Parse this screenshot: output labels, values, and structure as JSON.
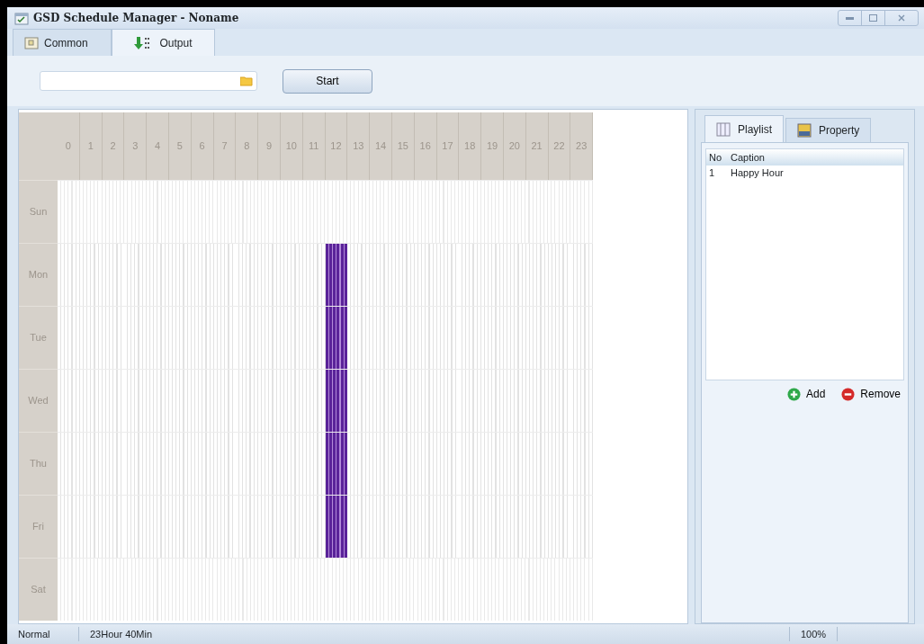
{
  "window": {
    "title": "GSD Schedule Manager - Noname"
  },
  "tabs": [
    {
      "label": "Common",
      "selected": false
    },
    {
      "label": "Output",
      "selected": true
    }
  ],
  "toolbar": {
    "button": "Start"
  },
  "schedule": {
    "hours": [
      "0",
      "1",
      "2",
      "3",
      "4",
      "5",
      "6",
      "7",
      "8",
      "9",
      "10",
      "11",
      "12",
      "13",
      "14",
      "15",
      "16",
      "17",
      "18",
      "19",
      "20",
      "21",
      "22",
      "23"
    ],
    "days": [
      {
        "label": "Sun"
      },
      {
        "label": "Mon",
        "hours": [
          {
            "scheduled": false
          },
          {
            "scheduled": false
          },
          {
            "scheduled": false
          },
          {
            "scheduled": false
          },
          {
            "scheduled": false
          },
          {
            "scheduled": false
          },
          {
            "scheduled": false
          },
          {
            "scheduled": false
          },
          {
            "scheduled": false
          },
          {
            "scheduled": false
          },
          {
            "scheduled": false
          },
          {
            "scheduled": false
          },
          {
            "scheduled": true
          },
          {
            "scheduled": false
          },
          {
            "scheduled": false
          },
          {
            "scheduled": false
          },
          {
            "scheduled": false
          },
          {
            "scheduled": false
          },
          {
            "scheduled": false
          },
          {
            "scheduled": false
          },
          {
            "scheduled": false
          },
          {
            "scheduled": false
          },
          {
            "scheduled": false
          },
          {
            "scheduled": false
          }
        ]
      },
      {
        "label": "Tue",
        "hours": [
          {
            "scheduled": false
          },
          {
            "scheduled": false
          },
          {
            "scheduled": false
          },
          {
            "scheduled": false
          },
          {
            "scheduled": false
          },
          {
            "scheduled": false
          },
          {
            "scheduled": false
          },
          {
            "scheduled": false
          },
          {
            "scheduled": false
          },
          {
            "scheduled": false
          },
          {
            "scheduled": false
          },
          {
            "scheduled": false
          },
          {
            "scheduled": true
          },
          {
            "scheduled": false
          },
          {
            "scheduled": false
          },
          {
            "scheduled": false
          },
          {
            "scheduled": false
          },
          {
            "scheduled": false
          },
          {
            "scheduled": false
          },
          {
            "scheduled": false
          },
          {
            "scheduled": false
          },
          {
            "scheduled": false
          },
          {
            "scheduled": false
          },
          {
            "scheduled": false
          }
        ]
      },
      {
        "label": "Wed",
        "hours": [
          {
            "scheduled": false
          },
          {
            "scheduled": false
          },
          {
            "scheduled": false
          },
          {
            "scheduled": false
          },
          {
            "scheduled": false
          },
          {
            "scheduled": false
          },
          {
            "scheduled": false
          },
          {
            "scheduled": false
          },
          {
            "scheduled": false
          },
          {
            "scheduled": false
          },
          {
            "scheduled": false
          },
          {
            "scheduled": false
          },
          {
            "scheduled": true
          },
          {
            "scheduled": false
          },
          {
            "scheduled": false
          },
          {
            "scheduled": false
          },
          {
            "scheduled": false
          },
          {
            "scheduled": false
          },
          {
            "scheduled": false
          },
          {
            "scheduled": false
          },
          {
            "scheduled": false
          },
          {
            "scheduled": false
          },
          {
            "scheduled": false
          },
          {
            "scheduled": false
          }
        ]
      },
      {
        "label": "Thu",
        "hours": [
          {
            "scheduled": false
          },
          {
            "scheduled": false
          },
          {
            "scheduled": false
          },
          {
            "scheduled": false
          },
          {
            "scheduled": false
          },
          {
            "scheduled": false
          },
          {
            "scheduled": false
          },
          {
            "scheduled": false
          },
          {
            "scheduled": false
          },
          {
            "scheduled": false
          },
          {
            "scheduled": false
          },
          {
            "scheduled": false
          },
          {
            "scheduled": true
          },
          {
            "scheduled": false
          },
          {
            "scheduled": false
          },
          {
            "scheduled": false
          },
          {
            "scheduled": false
          },
          {
            "scheduled": false
          },
          {
            "scheduled": false
          },
          {
            "scheduled": false
          },
          {
            "scheduled": false
          },
          {
            "scheduled": false
          },
          {
            "scheduled": false
          },
          {
            "scheduled": false
          }
        ]
      },
      {
        "label": "Fri",
        "hours": [
          {
            "scheduled": false
          },
          {
            "scheduled": false
          },
          {
            "scheduled": false
          },
          {
            "scheduled": false
          },
          {
            "scheduled": false
          },
          {
            "scheduled": false
          },
          {
            "scheduled": false
          },
          {
            "scheduled": false
          },
          {
            "scheduled": false
          },
          {
            "scheduled": false
          },
          {
            "scheduled": false
          },
          {
            "scheduled": false
          },
          {
            "scheduled": true
          },
          {
            "scheduled": false
          },
          {
            "scheduled": false
          },
          {
            "scheduled": false
          },
          {
            "scheduled": false
          },
          {
            "scheduled": false
          },
          {
            "scheduled": false
          },
          {
            "scheduled": false
          },
          {
            "scheduled": false
          },
          {
            "scheduled": false
          },
          {
            "scheduled": false
          },
          {
            "scheduled": false
          }
        ]
      },
      {
        "label": "Sat"
      }
    ]
  },
  "side_tabs": [
    {
      "label": "Playlist",
      "selected": true
    },
    {
      "label": "Property",
      "selected": false
    }
  ],
  "playlist": {
    "columns": [
      "No",
      "Caption"
    ],
    "rows": [
      {
        "no": "1",
        "caption": "Happy Hour"
      }
    ]
  },
  "actions": [
    {
      "kind": "add",
      "label": "Add"
    },
    {
      "kind": "remove",
      "label": "Remove"
    }
  ],
  "status_bar": [
    "Normal",
    "23Hour 40Min",
    "100%"
  ]
}
